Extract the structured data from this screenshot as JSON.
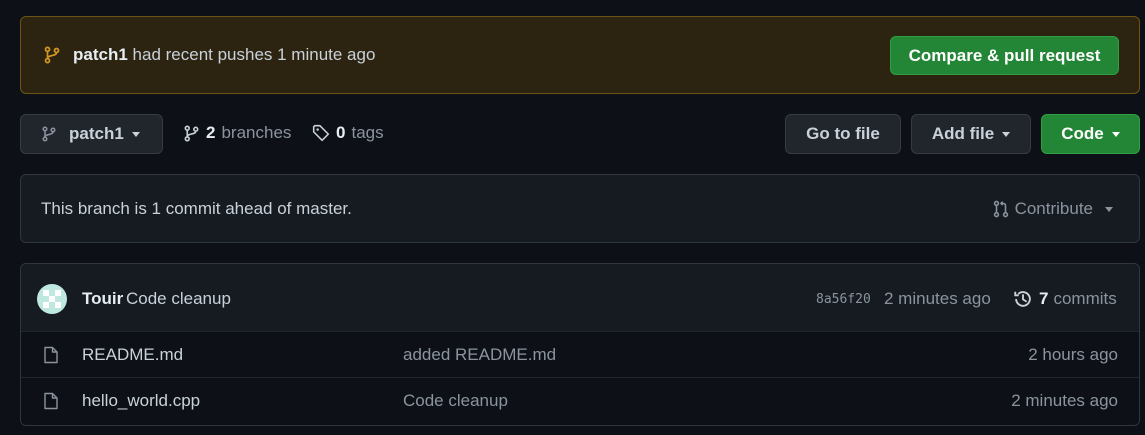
{
  "banner": {
    "branch": "patch1",
    "message": "had recent pushes 1 minute ago",
    "compare_label": "Compare & pull request"
  },
  "toolbar": {
    "branch_select": "patch1",
    "branches_count": "2",
    "branches_label": "branches",
    "tags_count": "0",
    "tags_label": "tags",
    "go_to_file": "Go to file",
    "add_file": "Add file",
    "code": "Code"
  },
  "ahead": {
    "message": "This branch is 1 commit ahead of master.",
    "contribute": "Contribute"
  },
  "latest_commit": {
    "author": "Touir",
    "message": "Code cleanup",
    "sha": "8a56f20",
    "time": "2 minutes ago",
    "commits_count": "7",
    "commits_label": "commits"
  },
  "files": [
    {
      "name": "README.md",
      "message": "added README.md",
      "time": "2 hours ago"
    },
    {
      "name": "hello_world.cpp",
      "message": "Code cleanup",
      "time": "2 minutes ago"
    }
  ],
  "colors": {
    "background": "#0d1117",
    "green": "#238636",
    "banner_bg": "#2c2410",
    "banner_icon": "#d29922"
  }
}
